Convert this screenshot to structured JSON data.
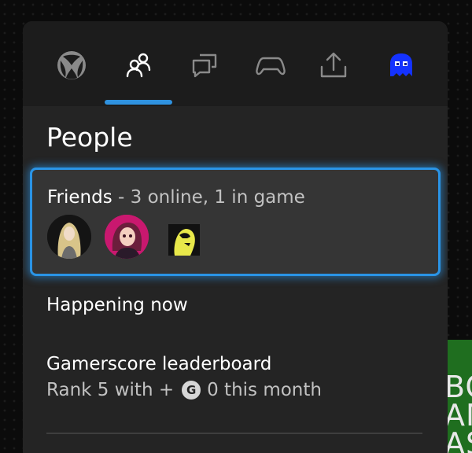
{
  "background": {
    "tile_text": "BO\nAM\nAS"
  },
  "tabs": [
    {
      "name": "xbox-home",
      "icon": "xbox-logo-icon",
      "selected": false
    },
    {
      "name": "people",
      "icon": "people-icon",
      "selected": true
    },
    {
      "name": "chat",
      "icon": "chat-icon",
      "selected": false
    },
    {
      "name": "controller",
      "icon": "controller-icon",
      "selected": false
    },
    {
      "name": "share",
      "icon": "share-icon",
      "selected": false
    },
    {
      "name": "profile",
      "icon": "ghost-avatar-icon",
      "selected": false
    }
  ],
  "accent_color": "#2f92e0",
  "title": "People",
  "friends": {
    "label": "Friends",
    "status": " - 3 online, 1 in game",
    "avatars": [
      "blonde-woman-avatar",
      "pink-haired-girl-avatar",
      "yellow-silhouette-avatar"
    ]
  },
  "happening_now": {
    "label": "Happening now"
  },
  "leaderboard": {
    "label": "Gamerscore leaderboard",
    "rank_prefix": "Rank 5 with +",
    "badge": "G",
    "rank_suffix": "0 this month"
  }
}
